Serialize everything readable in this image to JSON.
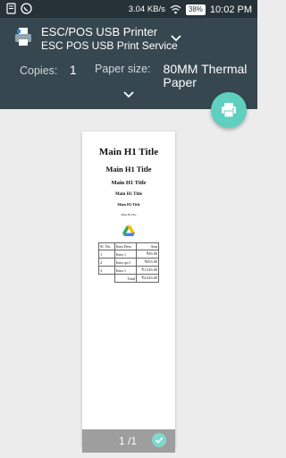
{
  "status_bar": {
    "network_speed": "3.04 KB/s",
    "battery": "38%",
    "time": "10:02 PM",
    "icons": [
      "notification-icon",
      "whatsapp-icon",
      "wifi-icon",
      "battery-icon"
    ]
  },
  "printer": {
    "name": "ESC/POS USB Printer",
    "service": "ESC POS USB Print Service"
  },
  "options": {
    "copies_label": "Copies:",
    "copies_value": "1",
    "paper_label": "Paper size:",
    "paper_value_line1": "80MM Thermal",
    "paper_value_line2": "Paper"
  },
  "preview": {
    "h1": "Main H1 Title",
    "h2": "Main H1 Title",
    "h3": "Main H1 Title",
    "h4": "Main H1 Title",
    "h5": "Main H1 Title",
    "h6": "Main H1 Title",
    "table": {
      "headers": [
        "Sl. No.",
        "Item Desc",
        "Amt"
      ],
      "rows": [
        [
          "1",
          "Item 1",
          "₹45.00"
        ],
        [
          "2",
          "Item qw1",
          "₹453.00"
        ],
        [
          "3",
          "Item 1",
          "₹1,545.00"
        ]
      ],
      "total_label": "Total",
      "total_value": "₹2,043.00"
    }
  },
  "page_bar": {
    "count": "1 /1"
  },
  "colors": {
    "header": "#37474f",
    "status_bar": "#263238",
    "fab": "#5fcfc0",
    "page_bar": "#9e9e9e"
  }
}
